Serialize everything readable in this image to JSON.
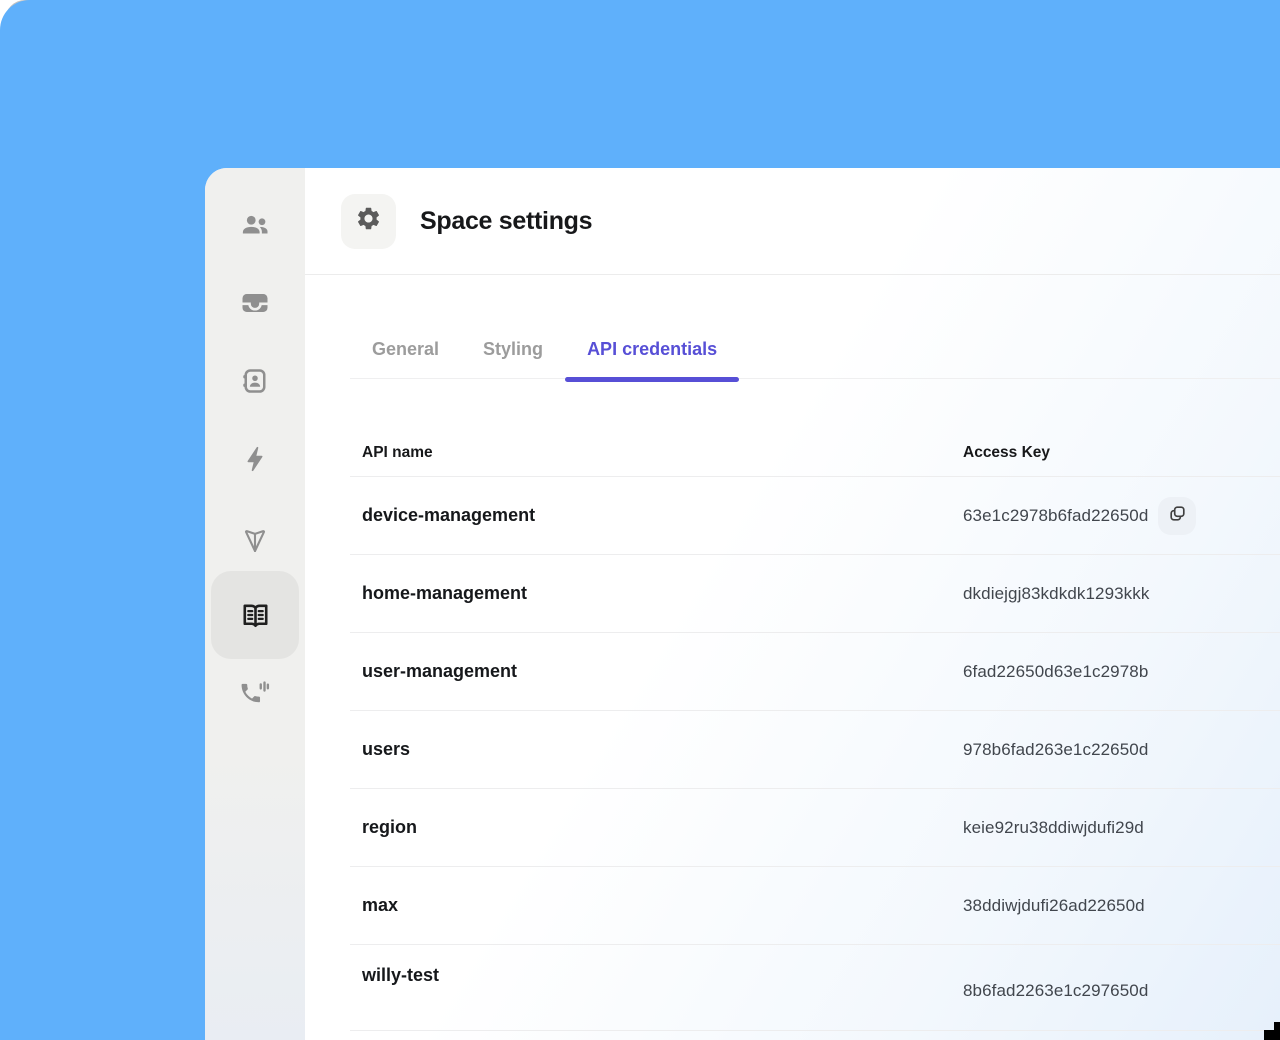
{
  "app": {
    "background_color": "#5fb0fb",
    "accent_color": "#574fd6"
  },
  "sidebar": {
    "items": [
      {
        "icon": "people-icon",
        "selected": false
      },
      {
        "icon": "inbox-icon",
        "selected": false
      },
      {
        "icon": "contact-card-icon",
        "selected": false
      },
      {
        "icon": "lightning-icon",
        "selected": false
      },
      {
        "icon": "send-icon",
        "selected": false
      },
      {
        "icon": "book-icon",
        "selected": true
      },
      {
        "icon": "phone-icon",
        "selected": false
      }
    ]
  },
  "header": {
    "icon": "gear-icon",
    "title": "Space settings"
  },
  "tabs": [
    {
      "label": "General",
      "active": false
    },
    {
      "label": "Styling",
      "active": false
    },
    {
      "label": "API credentials",
      "active": true
    }
  ],
  "table": {
    "columns": [
      "API name",
      "Access Key"
    ],
    "rows": [
      {
        "name": "device-management",
        "key": "63e1c2978b6fad22650d",
        "copy_button": true
      },
      {
        "name": "home-management",
        "key": "dkdiejgj83kdkdk1293kkk",
        "copy_button": false
      },
      {
        "name": "user-management",
        "key": "6fad22650d63e1c2978b",
        "copy_button": false
      },
      {
        "name": "users",
        "key": "978b6fad263e1c22650d",
        "copy_button": false
      },
      {
        "name": "region",
        "key": "keie92ru38ddiwjdufi29d",
        "copy_button": false
      },
      {
        "name": "max",
        "key": "38ddiwjdufi26ad22650d",
        "copy_button": false
      },
      {
        "name": "willy-test",
        "key": "8b6fad2263e1c297650d",
        "copy_button": false
      }
    ]
  }
}
